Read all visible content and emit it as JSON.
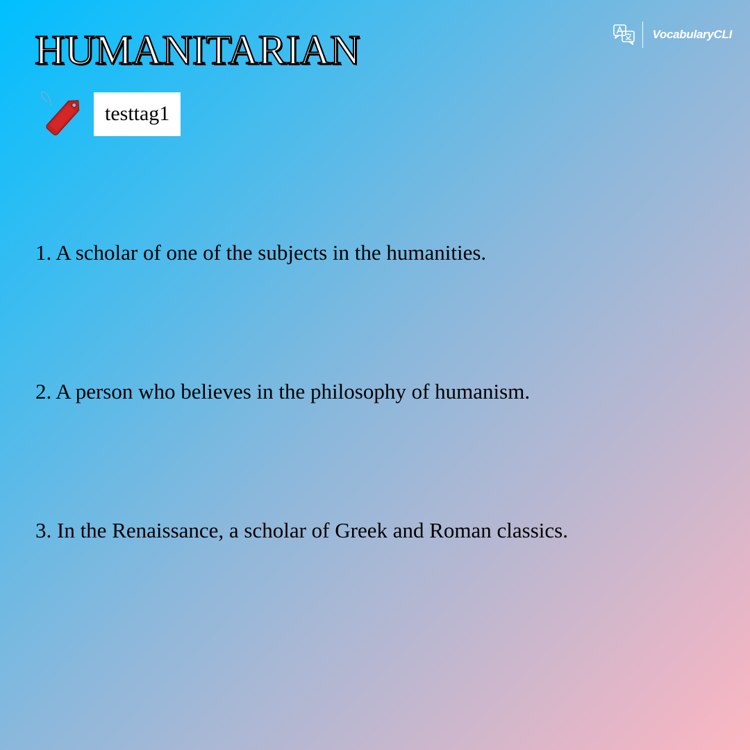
{
  "word": "HUMANITARIAN",
  "brand": {
    "name": "VocabularyCLI",
    "icon": "translate-icon"
  },
  "tag": {
    "icon": "price-tag-icon",
    "label": "testtag1"
  },
  "definitions": [
    "1. A scholar of one of the subjects in the humanities.",
    "2. A person who believes in the philosophy of humanism.",
    "3. In the Renaissance, a scholar of Greek and Roman classics."
  ],
  "colors": {
    "gradient_start": "#00bfff",
    "gradient_mid": "#8ab8dc",
    "gradient_end": "#fdb6c1",
    "tag_red": "#c81e1e",
    "text": "#000000",
    "title_fill": "#ffffff"
  }
}
